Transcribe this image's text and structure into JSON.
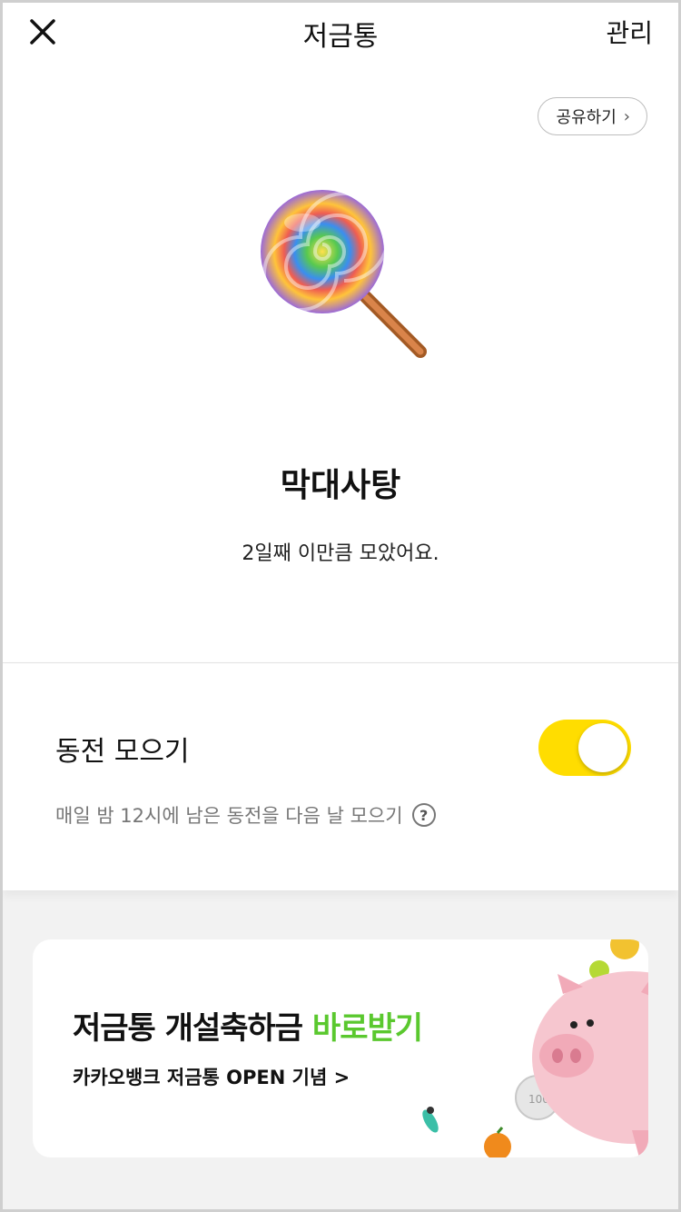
{
  "header": {
    "title": "저금통",
    "manage_label": "관리"
  },
  "goal": {
    "share_label": "공유하기",
    "name": "막대사탕",
    "description": "2일째 이만큼 모았어요."
  },
  "coin": {
    "label": "동전 모으기",
    "toggle_on": true,
    "description": "매일 밤 12시에 남은 동전을 다음 날 모으기",
    "help_glyph": "?"
  },
  "banner": {
    "title_main": "저금통 개설축하금 ",
    "title_accent": "바로받기",
    "subtitle": "카카오뱅크 저금통 OPEN 기념 >"
  },
  "colors": {
    "toggle": "#ffdd00",
    "accent_green": "#5ac82e",
    "pig": "#f6c6cf"
  },
  "icons": [
    "close-icon",
    "chevron-right-icon",
    "lollipop-icon",
    "help-icon",
    "piggy-bank-icon",
    "coin-icon"
  ]
}
